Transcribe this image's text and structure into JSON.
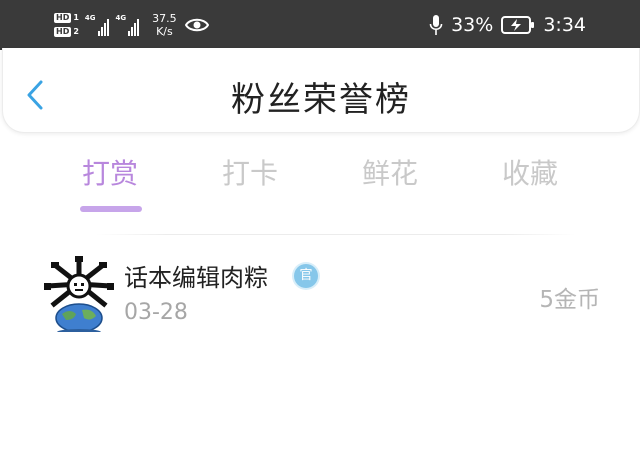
{
  "status_bar": {
    "hd1": "HD",
    "hd1_num": "1",
    "hd2": "HD",
    "hd2_num": "2",
    "net1": "4G",
    "net2": "4G",
    "speed_value": "37.5",
    "speed_unit": "K/s",
    "battery_percent": "33%",
    "time": "3:34"
  },
  "nav": {
    "title": "粉丝荣誉榜"
  },
  "tabs": [
    {
      "label": "打赏",
      "active": true
    },
    {
      "label": "打卡",
      "active": false
    },
    {
      "label": "鲜花",
      "active": false
    },
    {
      "label": "收藏",
      "active": false
    }
  ],
  "entries": [
    {
      "name": "话本编辑肉粽",
      "badge": "官",
      "date": "03-28",
      "amount": "5金币"
    }
  ],
  "colors": {
    "accent_purple": "#b887dd",
    "underline_purple": "#c7a5ea",
    "back_blue": "#3aa3e3",
    "badge_blue": "#86c7ea",
    "status_bg": "#3a3a3a"
  },
  "icons": {
    "back": "chevron-left-icon",
    "eye": "eye-icon",
    "mic": "microphone-icon",
    "battery": "battery-charging-icon"
  }
}
